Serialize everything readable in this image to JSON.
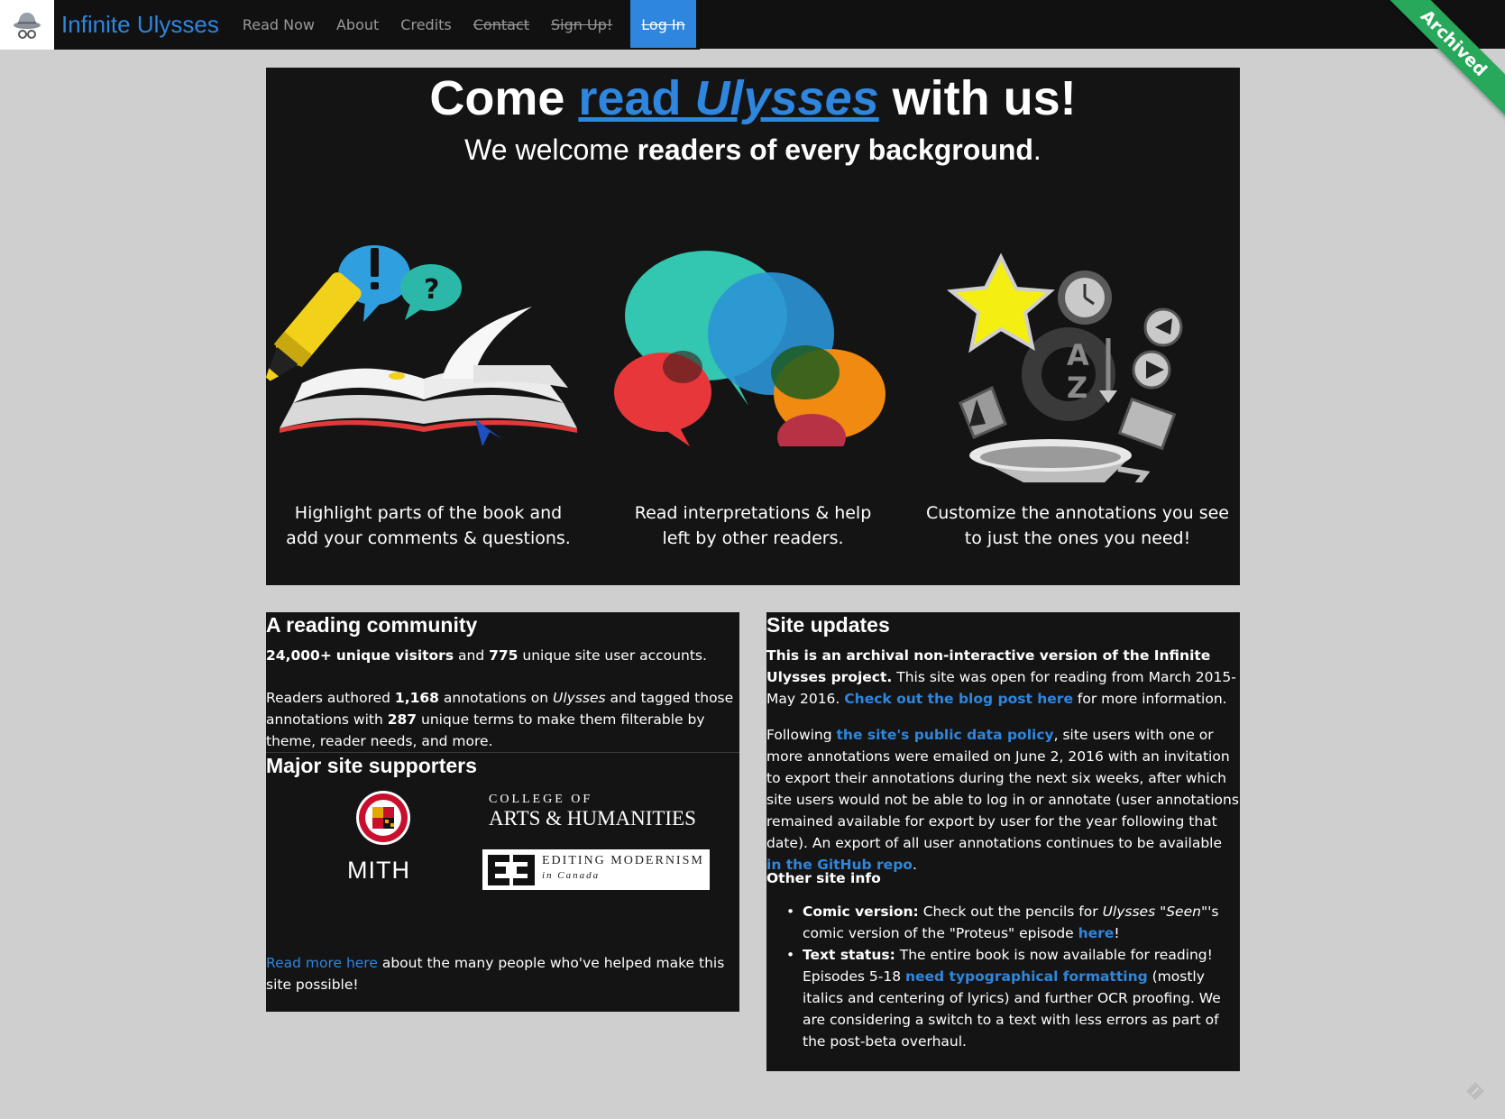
{
  "navbar": {
    "brand": "Infinite Ulysses",
    "items": [
      {
        "label": "Read Now",
        "strike": false
      },
      {
        "label": "About",
        "strike": false
      },
      {
        "label": "Credits",
        "strike": false
      },
      {
        "label": "Contact",
        "strike": true
      },
      {
        "label": "Sign Up!",
        "strike": true
      }
    ],
    "active": "Log In",
    "ribbon": "Archived"
  },
  "hero": {
    "title_pre": "Come ",
    "title_link_read": "read",
    "title_link_ulysses": "Ulysses",
    "title_post": " with us!",
    "subtitle_pre": "We welcome ",
    "subtitle_bold": "readers of every background",
    "subtitle_post": ".",
    "features": [
      {
        "line1": "Highlight parts of the book and",
        "line2": "add your comments & questions."
      },
      {
        "line1": "Read interpretations & help",
        "line2": "left by other readers."
      },
      {
        "line1": "Customize the annotations you see",
        "line2": "to just the ones you need!"
      }
    ]
  },
  "community": {
    "title": "A reading community",
    "visitors": "24,000+",
    "visitors_label": "unique visitors",
    "and": "and",
    "accounts": "775",
    "accounts_label": "unique site user accounts.",
    "p2_a": "Readers authored ",
    "annotations": "1,168",
    "p2_b": " annotations on ",
    "p2_ulysses": "Ulysses",
    "p2_c": " and tagged those annotations with ",
    "terms": "287",
    "p2_d": " unique terms to make them filterable by theme, reader needs, and more."
  },
  "supporters": {
    "title": "Major site supporters",
    "mith": "MITH",
    "arts_line1": "COLLEGE OF",
    "arts_line2": "ARTS & HUMANITIES",
    "em_line1": "EDITING MODERNISM",
    "em_line2": "in Canada",
    "readmore_link": "Read more here",
    "readmore_text": " about the many people who've helped make this site possible!"
  },
  "updates": {
    "title": "Site updates",
    "p1_bold": "This is an archival non-interactive version of the Infinite Ulysses project.",
    "p1_text": " This site was open for reading from March 2015-May 2016. ",
    "p1_link": "Check out the blog post here",
    "p1_end": " for more information.",
    "p2_a": "Following ",
    "p2_link": "the site's public data policy",
    "p2_b": ", site users with one or more annotations were emailed on June 2, 2016 with an invitation to export their annotations during the next six weeks, after which site users would not be able to log in or annotate (user annotations remained available for export by user for the year following that date). An export of all user annotations continues to be available ",
    "p2_link2": "in the GitHub repo",
    "p2_end": ".",
    "other_title": "Other site info",
    "item1_bold": "Comic version:",
    "item1_a": " Check out the pencils for ",
    "item1_i": "Ulysses \"Seen\"",
    "item1_b": "'s comic version of the \"Proteus\" episode ",
    "item1_link": "here",
    "item1_end": "!",
    "item2_bold": "Text status:",
    "item2_a": " The entire book is now available for reading! Episodes 5-18 ",
    "item2_link": "need typographical formatting",
    "item2_b": " (mostly italics and centering of lyrics) and further OCR proofing. We are considering a switch to a text with less errors as part of the post-beta overhaul."
  },
  "colors": {
    "accent": "#2e86de",
    "ribbon": "#27a85a",
    "panel": "#141414",
    "page_bg": "#cfcfcf"
  },
  "icons": [
    "spy-hat-logo-icon",
    "edit-pencil-icon"
  ]
}
